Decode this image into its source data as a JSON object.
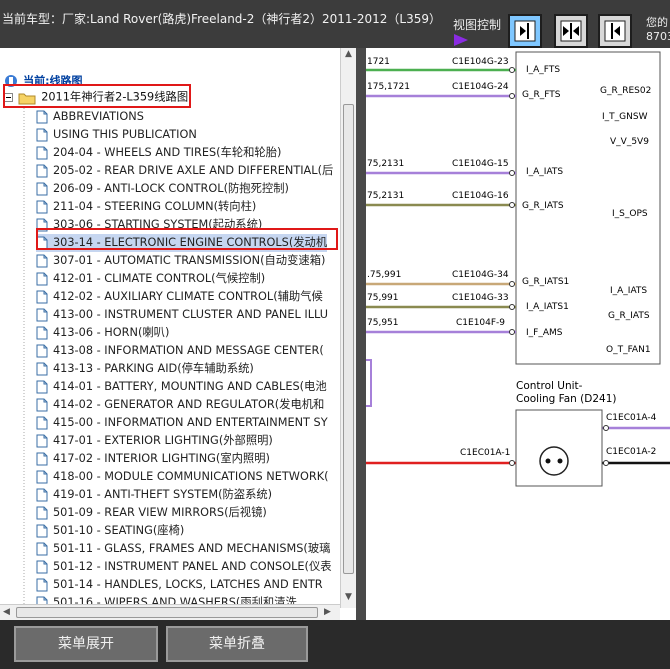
{
  "header": {
    "vehicle_title": "当前车型：厂家:Land Rover(路虎)Freeland-2（神行者2）2011-2012（L359）",
    "view_control_label": "视图控制",
    "corner_text_line1": "您的",
    "corner_text_line2": "8703"
  },
  "tree": {
    "current_label": "当前:线路图",
    "root_label": "2011年神行者2-L359线路图",
    "items": [
      "ABBREVIATIONS",
      "USING THIS PUBLICATION",
      "204-04 - WHEELS AND TIRES(车轮和轮胎)",
      "205-02 - REAR DRIVE AXLE AND DIFFERENTIAL(后",
      "206-09 - ANTI-LOCK CONTROL(防抱死控制)",
      "211-04 - STEERING COLUMN(转向柱)",
      "303-06 - STARTING SYSTEM(起动系统)",
      "303-14 - ELECTRONIC ENGINE CONTROLS(发动机",
      "307-01 - AUTOMATIC TRANSMISSION(自动变速箱)",
      "412-01 - CLIMATE CONTROL(气候控制)",
      "412-02 - AUXILIARY CLIMATE CONTROL(辅助气候",
      "413-00 - INSTRUMENT CLUSTER AND PANEL ILLU",
      "413-06 - HORN(喇叭)",
      "413-08 - INFORMATION AND MESSAGE CENTER(",
      "413-13 - PARKING AID(停车辅助系统)",
      "414-01 - BATTERY, MOUNTING AND CABLES(电池",
      "414-02 - GENERATOR AND REGULATOR(发电机和",
      "415-00 - INFORMATION AND ENTERTAINMENT SY",
      "417-01 - EXTERIOR LIGHTING(外部照明)",
      "417-02 - INTERIOR LIGHTING(室内照明)",
      "418-00 - MODULE COMMUNICATIONS NETWORK(",
      "419-01 - ANTI-THEFT SYSTEM(防盗系统)",
      "501-09 - REAR VIEW MIRRORS(后视镜)",
      "501-10 - SEATING(座椅)",
      "501-11 - GLASS, FRAMES AND MECHANISMS(玻璃",
      "501-12 - INSTRUMENT PANEL AND CONSOLE(仪表",
      "501-14 - HANDLES, LOCKS, LATCHES AND ENTR",
      "501-16 - WIPERS AND WASHERS(雨刮和清洗"
    ]
  },
  "diagram": {
    "wires_left": [
      "1721",
      "175,1721",
      "75,2131",
      "75,2131",
      ".75,991",
      "75,991",
      "75,951"
    ],
    "connectors": [
      "C1E104G-23",
      "C1E104G-24",
      "C1E104G-15",
      "C1E104G-16",
      "C1E104G-34",
      "C1E104G-33",
      "C1E104F-9"
    ],
    "pins_left": [
      "I_A_FTS",
      "G_R_FTS",
      "I_A_IATS",
      "G_R_IATS",
      "G_R_IATS1",
      "I_A_IATS1",
      "I_F_AMS"
    ],
    "pins_right": [
      "G_R_RES02",
      "I_T_GNSW",
      "V_V_5V9",
      "I_S_OPS",
      "I_A_IATS",
      "G_R_IATS",
      "O_T_FAN1"
    ],
    "fan_title_line1": "Control Unit-",
    "fan_title_line2": "Cooling Fan (D241)",
    "fan_conn_left": "C1EC01A-1",
    "fan_conn_right1": "C1EC01A-4",
    "fan_conn_right2": "C1EC01A-2"
  },
  "footer": {
    "expand_label": "菜单展开",
    "collapse_label": "菜单折叠"
  },
  "colors": {
    "selected_bg": "#c6d6f0",
    "highlight_box": "#e01818",
    "active_view_button": "#7fc7ff"
  }
}
